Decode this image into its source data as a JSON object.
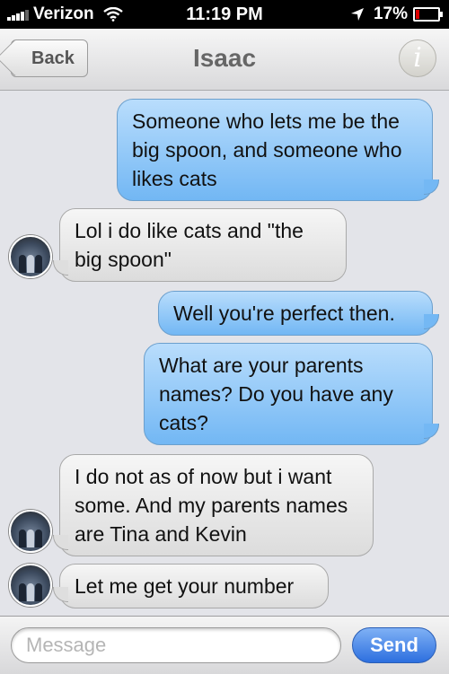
{
  "status_bar": {
    "carrier": "Verizon",
    "time": "11:19 PM",
    "battery": "17%",
    "battery_level": 0.17,
    "icons": [
      "signal-bars-icon",
      "wifi-icon",
      "location-arrow-icon",
      "battery-icon"
    ]
  },
  "navbar": {
    "back_label": "Back",
    "title": "Isaac",
    "info_glyph": "i"
  },
  "messages": [
    {
      "side": "sent",
      "text": "Someone who lets me be the big spoon, and someone who likes cats"
    },
    {
      "side": "received",
      "text": "Lol i do like cats and \"the big spoon\""
    },
    {
      "side": "sent",
      "text": "Well you're perfect then."
    },
    {
      "side": "sent",
      "text": "What are your parents names? Do you have any cats?"
    },
    {
      "side": "received",
      "text": "I do not as of now but i want some. And my parents names are Tina and Kevin"
    },
    {
      "side": "received",
      "text": "Let me get your number"
    }
  ],
  "composer": {
    "placeholder": "Message",
    "value": "",
    "send_label": "Send"
  },
  "colors": {
    "sent_bubble": "#72b7f4",
    "received_bubble": "#dcdcdc",
    "send_button": "#2d6fdf",
    "background": "#e3e4e9"
  }
}
